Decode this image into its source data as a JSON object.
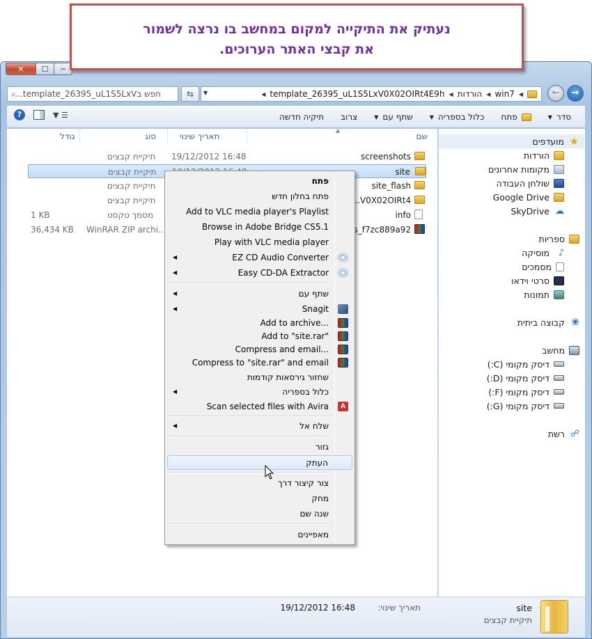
{
  "callout": {
    "line1": "נעתיק את התיקייה למקום במחשב בו נרצה לשמור",
    "line2": "את קבצי האתר הערוכים."
  },
  "window": {
    "close": "✕",
    "maximize": "☐",
    "minimize": "─"
  },
  "address": {
    "crumbs": [
      "win7",
      "הורדות",
      "template_26395_uL1S5LxV0X02OIRt4E9h"
    ],
    "search_placeholder": "חפש בtemplate_26395_uL1S5LxV..."
  },
  "toolbar": {
    "organize": "סדר",
    "open": "פתח",
    "include_library": "כלול בספריה",
    "share_with": "שתף עם",
    "burn": "צרוב",
    "new_folder": "תיקיה חדשה"
  },
  "nav": {
    "favorites": "מועדפים",
    "downloads": "הורדות",
    "recent": "מקומות אחרונים",
    "desktop": "שולחן העבודה",
    "google_drive": "Google Drive",
    "skydrive": "SkyDrive",
    "libraries": "ספריות",
    "music": "מוסיקה",
    "documents": "מסמכים",
    "videos": "סרטי וידאו",
    "pictures": "תמונות",
    "homegroup": "קבוצה ביתית",
    "computer": "מחשב",
    "disk_c": "דיסק מקומי (C:)",
    "disk_d": "דיסק מקומי (D:)",
    "disk_f": "דיסק מקומי (F:)",
    "disk_g": "דיסק מקומי (G:)",
    "network": "רשת"
  },
  "columns": {
    "name": "שם",
    "modified": "תאריך שינוי",
    "type": "סוג",
    "size": "גודל"
  },
  "files": [
    {
      "name": "screenshots",
      "modified": "19/12/2012 16:48",
      "type": "תיקיית קבצים",
      "size": "",
      "icon": "folder"
    },
    {
      "name": "site",
      "modified": "19/12/2012 16:48",
      "type": "תיקיית קבצים",
      "size": "",
      "icon": "folder"
    },
    {
      "name": "site_flash",
      "modified": "",
      "type": "תיקיית קבצים",
      "size": "",
      "icon": "folder"
    },
    {
      "name": "...V0X02OIRt4",
      "modified": "",
      "type": "תיקיית קבצים",
      "size": "",
      "icon": "folder"
    },
    {
      "name": "info",
      "modified": "",
      "type": "מסמך טקסט",
      "size": "1 KB",
      "icon": "text"
    },
    {
      "name": "es_f7zc889a92",
      "modified": "",
      "type": "WinRAR ZIP archi...",
      "size": "36,434 KB",
      "icon": "rar"
    }
  ],
  "menu": {
    "open": "פתח",
    "open_new_window": "פתח בחלון חדש",
    "vlc_playlist": "Add to VLC media player's Playlist",
    "bridge": "Browse in Adobe Bridge CS5.1",
    "vlc_play": "Play with VLC media player",
    "ez_cd": "EZ CD Audio Converter",
    "easy_cd": "Easy CD-DA Extractor",
    "share_with": "שתף עם",
    "snagit": "Snagit",
    "add_archive": "Add to archive...",
    "add_site_rar": "Add to \"site.rar\"",
    "compress_email": "Compress and email...",
    "compress_site_email": "Compress to \"site.rar\" and email",
    "restore": "שחזור גירסאות קודמות",
    "include_library": "כלול בספריה",
    "avira": "Scan selected files with Avira",
    "send_to": "שלח אל",
    "cut": "גזור",
    "copy": "העתק",
    "shortcut": "צור קיצור דרך",
    "delete": "מחק",
    "rename": "שנה שם",
    "properties": "מאפיינים"
  },
  "details": {
    "name": "site",
    "type": "תיקיית קבצים",
    "modified_label": "תאריך שינוי:",
    "modified_value": "19/12/2012 16:48"
  },
  "colors": {
    "callout_text": "#7030a0",
    "callout_border": "#c0504d",
    "selection": "#c4ddf9"
  }
}
